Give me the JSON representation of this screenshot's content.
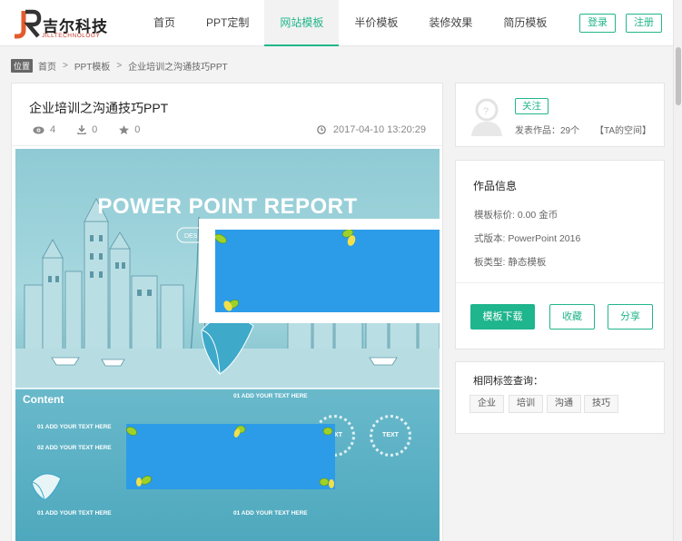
{
  "header": {
    "logo_name": "吉尔科技",
    "logo_sub": "JILLTECHNOLOGY",
    "nav": [
      "首页",
      "PPT定制",
      "网站模板",
      "半价模板",
      "装修效果",
      "简历模板"
    ],
    "login": "登录",
    "register": "注册"
  },
  "breadcrumb": {
    "tag": "位置",
    "items": [
      "首页",
      "PPT模板",
      "企业培训之沟通技巧PPT"
    ],
    "sep": ">"
  },
  "article": {
    "title": "企业培训之沟通技巧PPT",
    "views": "4",
    "downloads": "0",
    "likes": "0",
    "date": "2017-04-10 13:20:29"
  },
  "preview": {
    "slide_title": "POWER POINT REPORT",
    "content_label": "Content",
    "add_text_1": "01 ADD YOUR TEXT HERE",
    "add_text_2": "01 ADD YOUR TEXT HERE",
    "add_text_3": "02 ADD YOUR TEXT HERE",
    "add_text_4": "01 ADD YOUR TEXT HERE",
    "add_text_5": "01 ADD YOUR TEXT HERE",
    "circle_text": "TEXT",
    "design_text": "DES"
  },
  "author": {
    "follow": "关注",
    "works": "发表作品：29个",
    "space": "【TA的空间】"
  },
  "info": {
    "title": "作品信息",
    "price": "模板标价: 0.00 金币",
    "version": "式版本: PowerPoint 2016",
    "type": "板类型: 静态模板",
    "download": "模板下载",
    "favorite": "收藏",
    "share": "分享"
  },
  "tags": {
    "title": "相同标签查询：",
    "items": [
      "企业",
      "培训",
      "沟通",
      "技巧"
    ]
  },
  "colors": {
    "accent": "#22b68a",
    "overlay_blue": "#2c9ce8"
  }
}
